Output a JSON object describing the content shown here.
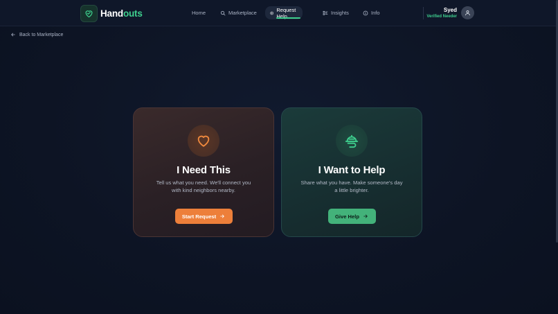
{
  "brand": {
    "name_part1": "Hand",
    "name_part2": "outs",
    "accent": "#3ecf8e"
  },
  "nav": {
    "home": "Home",
    "marketplace": "Marketplace",
    "request_help": "Request Help",
    "insights": "Insights",
    "info": "Info",
    "active": "request_help"
  },
  "user": {
    "name": "Syed",
    "role": "Verified Needer"
  },
  "back_link": "Back to Marketplace",
  "cards": {
    "need": {
      "title": "I Need This",
      "description": "Tell us what you need. We'll connect you with kind neighbors nearby.",
      "button": "Start Request",
      "color": "#ed7f3a"
    },
    "help": {
      "title": "I Want to Help",
      "description": "Share what you have. Make someone's day a little brighter.",
      "button": "Give Help",
      "color": "#43b27a"
    }
  },
  "icons": {
    "logo": "heart-hand-icon",
    "need": "heart-icon",
    "help": "serving-dish-icon"
  }
}
